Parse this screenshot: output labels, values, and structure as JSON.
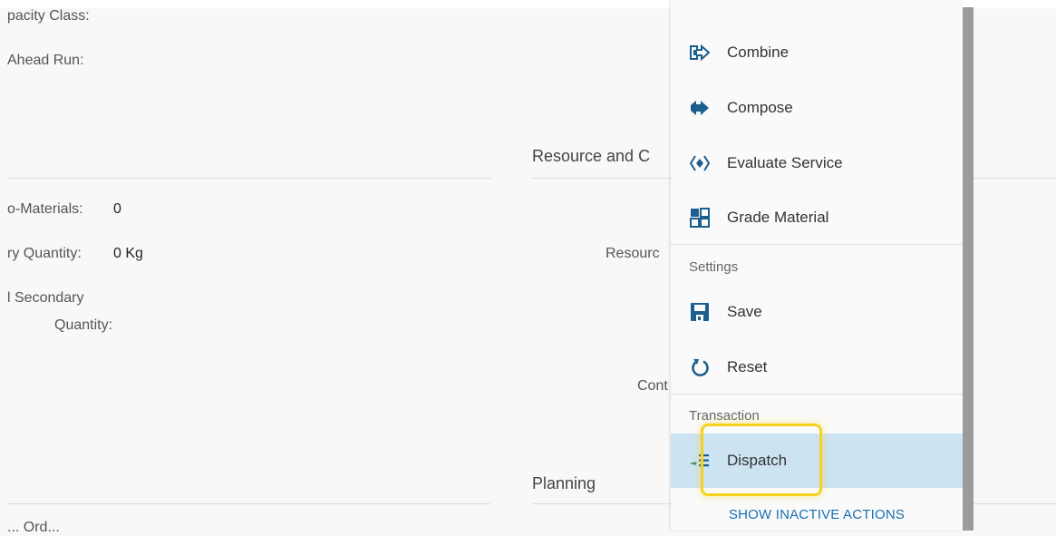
{
  "form": {
    "left_labels": {
      "opacity_class": "pacity Class:",
      "ahead_run": "Ahead Run:",
      "co_materials": "o-Materials:",
      "primary_quantity": "ry Quantity:",
      "secondary_line1": "l Secondary",
      "secondary_line2": "Quantity:",
      "bottom_partial": "... Ord..."
    },
    "left_values": {
      "co_materials": "0",
      "primary_quantity": "0 Kg"
    },
    "right": {
      "section_resource": "Resource and C",
      "resource_label": "Resourc",
      "cont_label": "Cont",
      "section_planning": "Planning"
    }
  },
  "menu": {
    "items_top": [
      {
        "label": "Combine",
        "icon": "combine-icon"
      },
      {
        "label": "Compose",
        "icon": "compose-icon"
      },
      {
        "label": "Evaluate Service",
        "icon": "evaluate-service-icon"
      },
      {
        "label": "Grade Material",
        "icon": "grade-material-icon"
      }
    ],
    "group_settings": "Settings",
    "items_settings": [
      {
        "label": "Save",
        "icon": "save-icon"
      },
      {
        "label": "Reset",
        "icon": "reset-icon"
      }
    ],
    "group_transaction": "Transaction",
    "items_transaction": [
      {
        "label": "Dispatch",
        "icon": "dispatch-icon"
      }
    ],
    "show_inactive": "SHOW INACTIVE ACTIONS"
  },
  "colors": {
    "icon_blue": "#1c5f8f",
    "selected_bg": "#cce3f2",
    "highlight": "#f6d11e",
    "link": "#1a6fb0"
  }
}
